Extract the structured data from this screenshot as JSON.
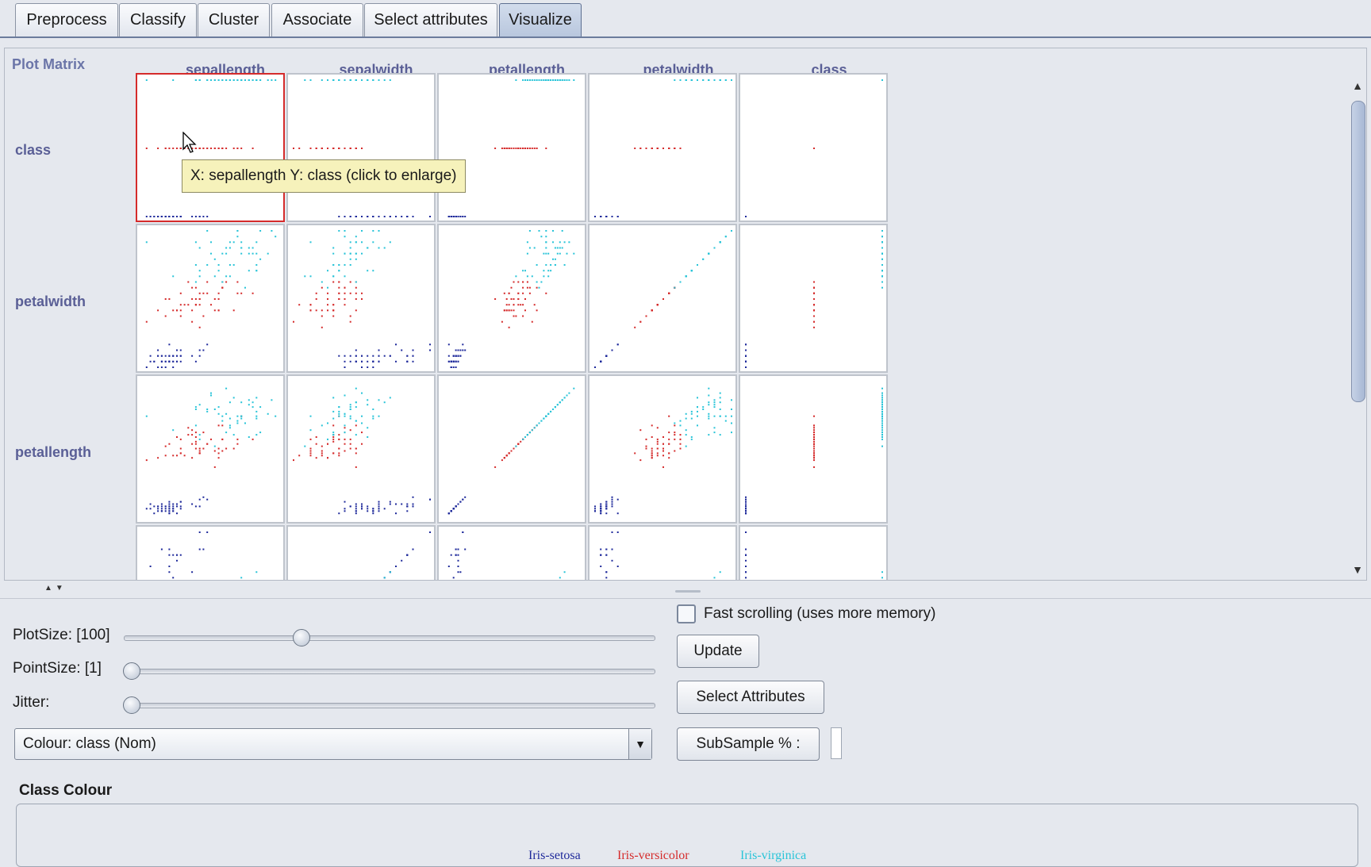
{
  "tabs": [
    {
      "label": "Preprocess",
      "active": false
    },
    {
      "label": "Classify",
      "active": false
    },
    {
      "label": "Cluster",
      "active": false
    },
    {
      "label": "Associate",
      "active": false
    },
    {
      "label": "Select attributes",
      "active": false
    },
    {
      "label": "Visualize",
      "active": true
    }
  ],
  "plot_matrix": {
    "title": "Plot Matrix",
    "columns": [
      "sepallength",
      "sepalwidth",
      "petallength",
      "petalwidth",
      "class"
    ],
    "rows": [
      "class",
      "petalwidth",
      "petallength"
    ],
    "tooltip": "X: sepallength Y: class (click to enlarge)",
    "highlighted_cell": "sepallength-class"
  },
  "controls": {
    "plot_size_label": "PlotSize: [100]",
    "plot_size_value": 0.33,
    "point_size_label": "PointSize: [1]",
    "point_size_value": 0.0,
    "jitter_label": "Jitter:",
    "jitter_value": 0.0,
    "colour_combo": "Colour: class  (Nom)",
    "fast_scrolling_label": "Fast scrolling (uses more memory)",
    "fast_scrolling_checked": false,
    "update_button": "Update",
    "select_attributes_button": "Select Attributes",
    "subsample_button": "SubSample % :",
    "subsample_value": ""
  },
  "class_colour": {
    "title": "Class Colour",
    "classes": [
      {
        "name": "Iris-setosa",
        "color": "#1f2a9b"
      },
      {
        "name": "Iris-versicolor",
        "color": "#d52b2b"
      },
      {
        "name": "Iris-virginica",
        "color": "#29c4d8"
      }
    ]
  },
  "colors": {
    "setosa": "#1f2a9b",
    "versicolor": "#d52b2b",
    "virginica": "#29c4d8",
    "highlight": "#d52b2b"
  }
}
